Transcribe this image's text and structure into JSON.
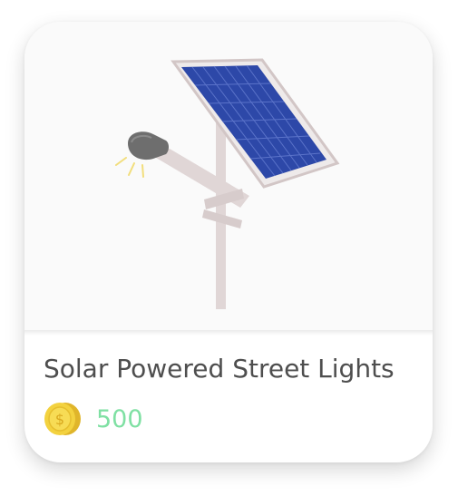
{
  "product": {
    "title": "Solar Powered Street Lights",
    "price": "500",
    "currency_icon": "gold-coin-icon",
    "image": "solar-street-light-illustration"
  },
  "colors": {
    "title_text": "#4e4e4e",
    "price_text": "#7fe0a3",
    "panel_blue": "#2d48a8",
    "pole": "#e0d6d6",
    "coin_gold": "#f3d23f"
  }
}
